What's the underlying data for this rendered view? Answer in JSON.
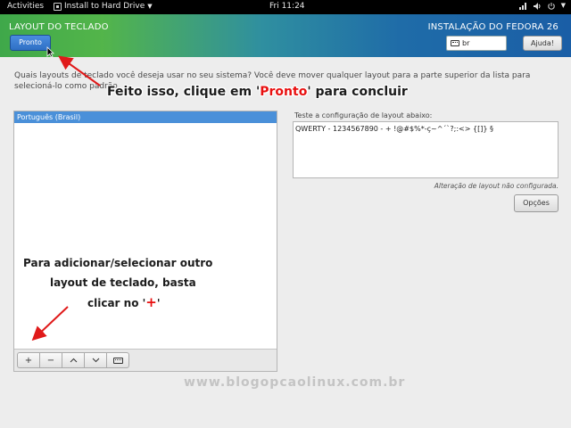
{
  "topbar": {
    "activities": "Activities",
    "app_name": "Install to Hard Drive",
    "clock": "Fri 11:24"
  },
  "header": {
    "title": "LAYOUT DO TECLADO",
    "subtitle": "INSTALAÇÃO DO FEDORA 26",
    "done_label": "Pronto",
    "language_value": "br",
    "help_label": "Ajuda!"
  },
  "instructions": "Quais layouts de teclado você deseja usar no seu sistema? Você deve mover qualquer layout para a parte superior da lista para selecioná-lo como padrão.",
  "annotations": {
    "top_pre": "Feito isso, clique em '",
    "top_red": "Pronto",
    "top_post": "' para concluir",
    "side_l1": "Para adicionar/selecionar outro",
    "side_l2": "layout de teclado, basta",
    "side_l3_pre": "clicar no '",
    "side_l3_red": "+",
    "side_l3_post": "'"
  },
  "layouts": [
    {
      "label": "Português (Brasil)"
    }
  ],
  "toolbar": {
    "add": "+",
    "remove": "−",
    "up": "︿",
    "down": "﹀"
  },
  "test": {
    "label": "Teste a configuração de layout abaixo:",
    "value": "QWERTY - 1234567890 - + !@#$%*-ç~^´`?;:<> {[]} §",
    "status": "Alteração de layout não configurada.",
    "options_label": "Opções"
  },
  "watermark": "www.blogopcaolinux.com.br",
  "colors": {
    "selected_row": "#4a90d9",
    "annotation_red": "#e81010",
    "arrow_red": "#e01a1a"
  }
}
